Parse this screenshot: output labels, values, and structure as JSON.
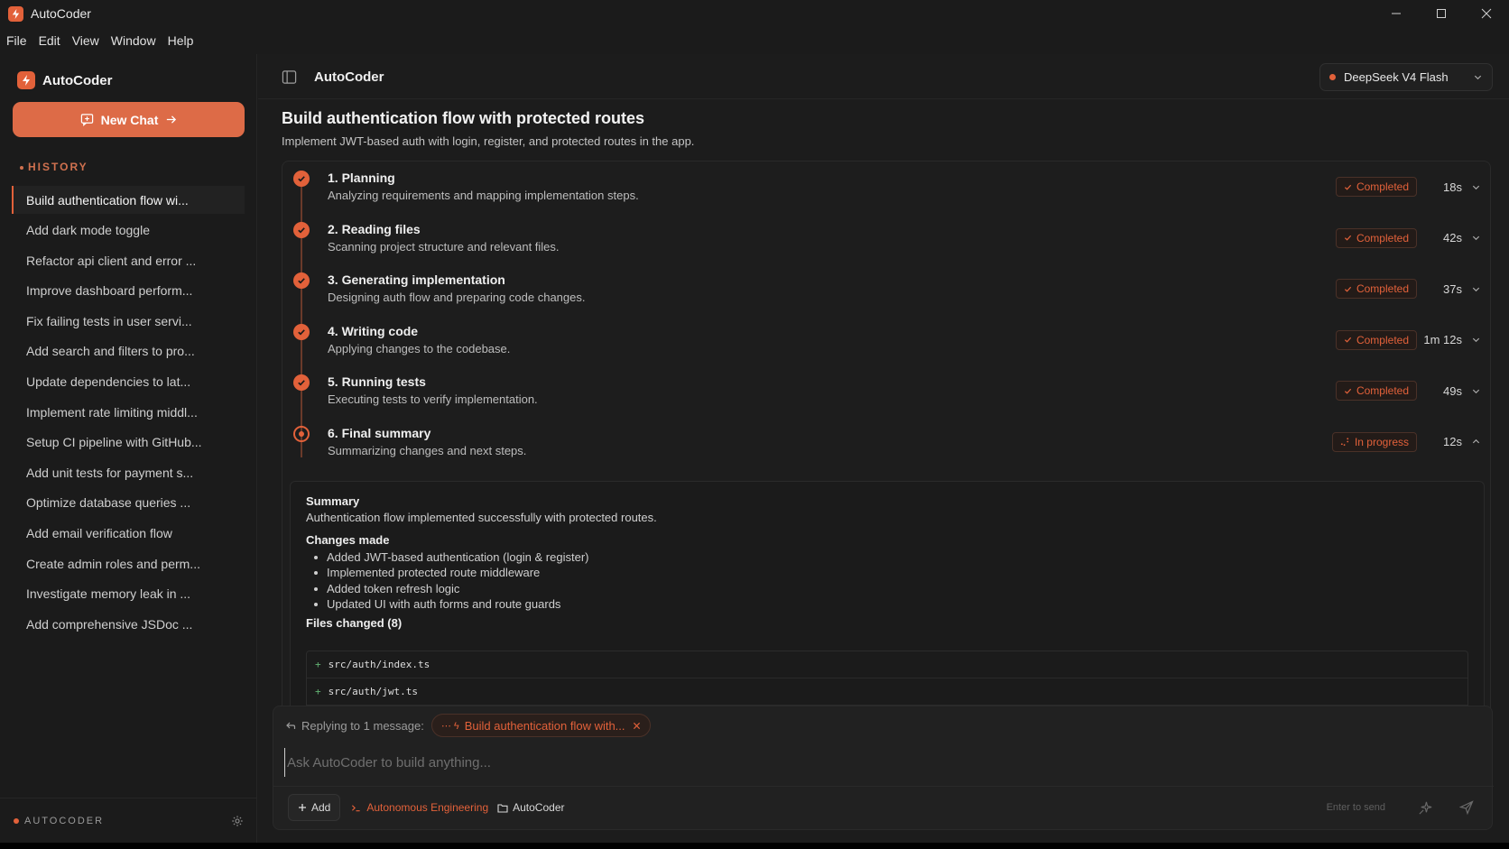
{
  "window": {
    "title": "AutoCoder"
  },
  "menu": [
    "File",
    "Edit",
    "View",
    "Window",
    "Help"
  ],
  "sidebar": {
    "brand": "AutoCoder",
    "new_chat_label": "New Chat",
    "history_label": "HISTORY",
    "history": [
      "Build authentication flow wi...",
      "Add dark mode toggle",
      "Refactor api client and error ...",
      "Improve dashboard perform...",
      "Fix failing tests in user servi...",
      "Add search and filters to pro...",
      "Update dependencies to lat...",
      "Implement rate limiting middl...",
      "Setup CI pipeline with GitHub...",
      "Add unit tests for payment s...",
      "Optimize database queries ...",
      "Add email verification flow",
      "Create admin roles and perm...",
      "Investigate memory leak in ...",
      "Add comprehensive JSDoc ..."
    ],
    "active_index": 0,
    "footer_label": "AUTOCODER"
  },
  "topbar": {
    "title": "AutoCoder",
    "model": "DeepSeek V4 Flash"
  },
  "task": {
    "title": "Build authentication flow with protected routes",
    "subtitle": "Implement JWT-based auth with login, register, and protected routes in the app."
  },
  "steps": [
    {
      "name": "1. Planning",
      "desc": "Analyzing requirements and mapping implementation steps.",
      "status": "Completed",
      "duration": "18s"
    },
    {
      "name": "2. Reading files",
      "desc": "Scanning project structure and relevant files.",
      "status": "Completed",
      "duration": "42s"
    },
    {
      "name": "3. Generating implementation",
      "desc": "Designing auth flow and preparing code changes.",
      "status": "Completed",
      "duration": "37s"
    },
    {
      "name": "4. Writing code",
      "desc": "Applying changes to the codebase.",
      "status": "Completed",
      "duration": "1m 12s"
    },
    {
      "name": "5. Running tests",
      "desc": "Executing tests to verify implementation.",
      "status": "Completed",
      "duration": "49s"
    },
    {
      "name": "6. Final summary",
      "desc": "Summarizing changes and next steps.",
      "status": "In progress",
      "duration": "12s"
    }
  ],
  "summary": {
    "heading": "Summary",
    "text": "Authentication flow implemented successfully with protected routes.",
    "changes_heading": "Changes made",
    "changes": [
      "Added JWT-based authentication (login & register)",
      "Implemented protected route middleware",
      "Added token refresh logic",
      "Updated UI with auth forms and route guards"
    ],
    "files_heading": "Files changed (8)",
    "files": [
      "src/auth/index.ts",
      "src/auth/jwt.ts"
    ]
  },
  "composer": {
    "replying_label": "Replying to 1 message:",
    "reply_chip": "Build authentication flow with...",
    "placeholder": "Ask AutoCoder to build anything...",
    "add_label": "Add",
    "mode_label": "Autonomous Engineering",
    "project_label": "AutoCoder",
    "enter_hint": "Enter to send"
  },
  "colors": {
    "accent": "#e2613a",
    "background": "#1b1b1b",
    "new_chat": "#dd6b47"
  }
}
